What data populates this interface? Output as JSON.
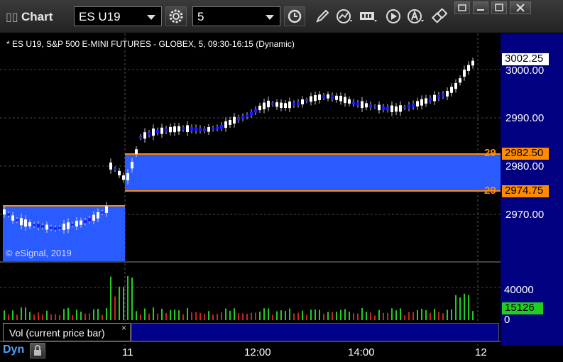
{
  "window": {
    "title": "Chart",
    "symbol_value": "ES U19",
    "interval_value": "5"
  },
  "chart": {
    "header": "* ES U19, S&P 500 E-MINI FUTURES - GLOBEX, 5, 09:30-16:15 (Dynamic)",
    "copyright": "© eSignal, 2019",
    "price_axis": [
      "3000.00",
      "2990.00",
      "2980.00",
      "2970.00"
    ],
    "last_price_tag": "3002.25",
    "level_upper_tag": "2982.50",
    "level_lower_tag": "2974.75",
    "level_upper_left": "29",
    "level_lower_left": "29",
    "time_axis": [
      "11",
      "12:00",
      "14:00",
      "12"
    ],
    "volume_axis": [
      "40000",
      "0"
    ],
    "volume_tag": "15126",
    "volume_study_label": "Vol (current price bar)",
    "volume_close_glyph": "×",
    "mode_label": "Dyn",
    "colors": {
      "up_candle": "#ffffff",
      "down_candle": "#1c1cff",
      "zone_fill": "#2a5bff",
      "level_line": "#ff8c00",
      "vol_up": "#22cc22",
      "vol_down": "#cc2222",
      "right_panel": "#000080"
    }
  }
}
